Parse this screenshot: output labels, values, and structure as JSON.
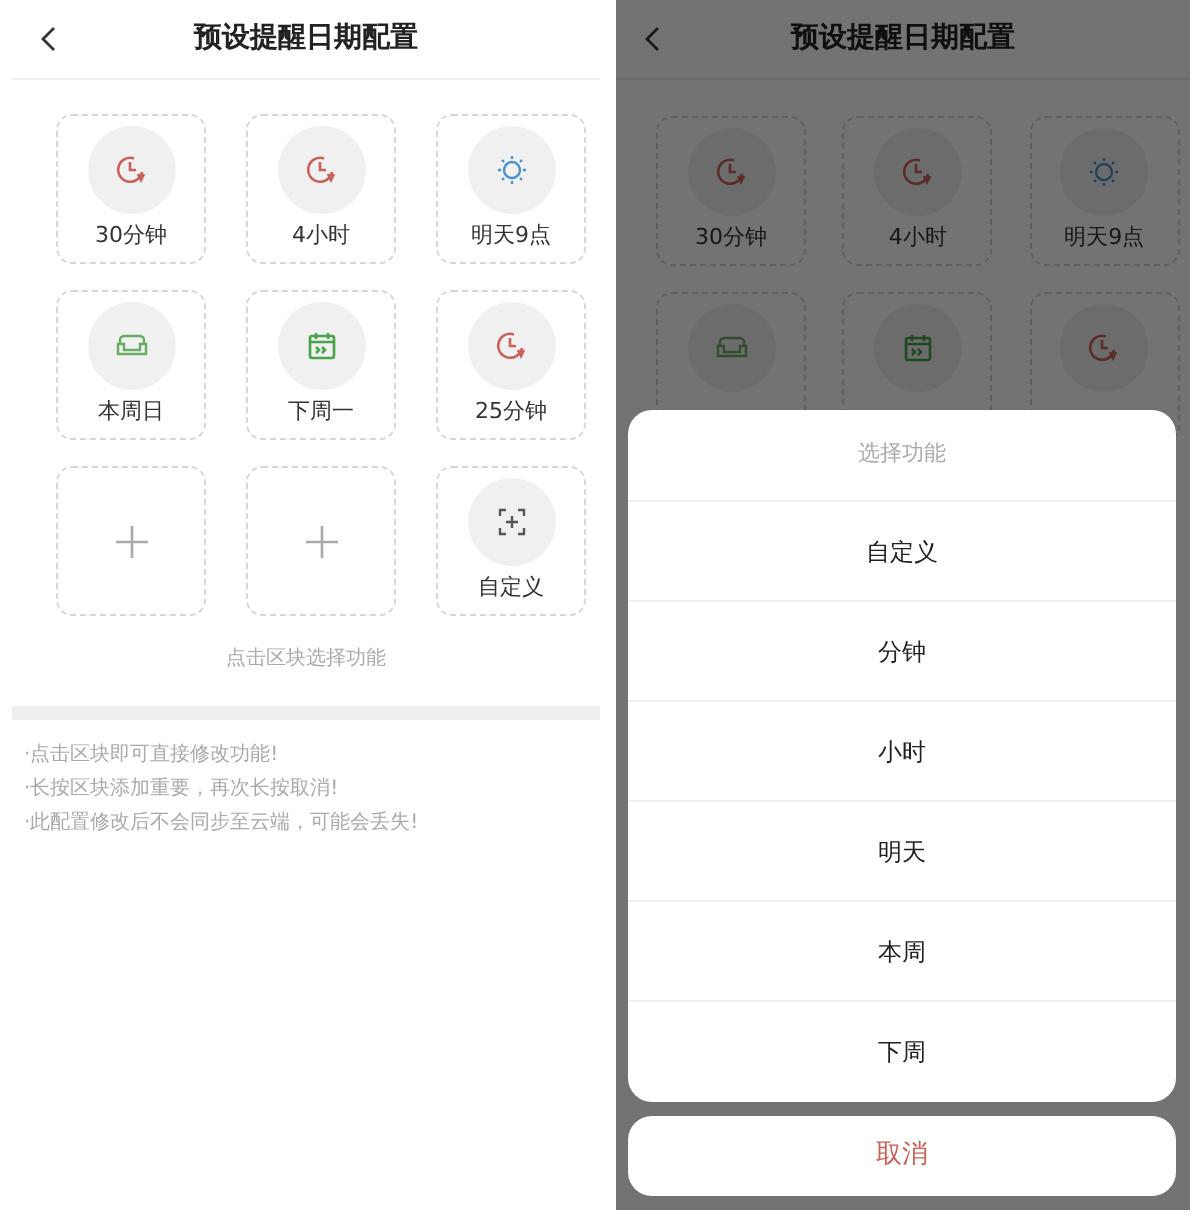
{
  "left": {
    "title": "预设提醒日期配置",
    "tiles": [
      {
        "kind": "clock",
        "label": "30分钟"
      },
      {
        "kind": "clock",
        "label": "4小时"
      },
      {
        "kind": "sun",
        "label": "明天9点"
      },
      {
        "kind": "sofa",
        "label": "本周日"
      },
      {
        "kind": "calendar",
        "label": "下周一"
      },
      {
        "kind": "clock",
        "label": "25分钟"
      },
      {
        "kind": "add"
      },
      {
        "kind": "add"
      },
      {
        "kind": "frame",
        "label": "自定义"
      }
    ],
    "hint": "点击区块选择功能",
    "notes": [
      "·点击区块即可直接修改功能!",
      "·长按区块添加重要，再次长按取消!",
      "·此配置修改后不会同步至云端，可能会丢失!"
    ]
  },
  "right": {
    "title": "预设提醒日期配置",
    "tiles": [
      {
        "kind": "clock",
        "label": "30分钟"
      },
      {
        "kind": "clock",
        "label": "4小时"
      },
      {
        "kind": "sun",
        "label": "明天9点"
      },
      {
        "kind": "sofa"
      },
      {
        "kind": "calendar"
      },
      {
        "kind": "clock"
      }
    ],
    "sheet": {
      "title": "选择功能",
      "options": [
        "自定义",
        "分钟",
        "小时",
        "明天",
        "本周",
        "下周"
      ],
      "cancel": "取消"
    }
  }
}
